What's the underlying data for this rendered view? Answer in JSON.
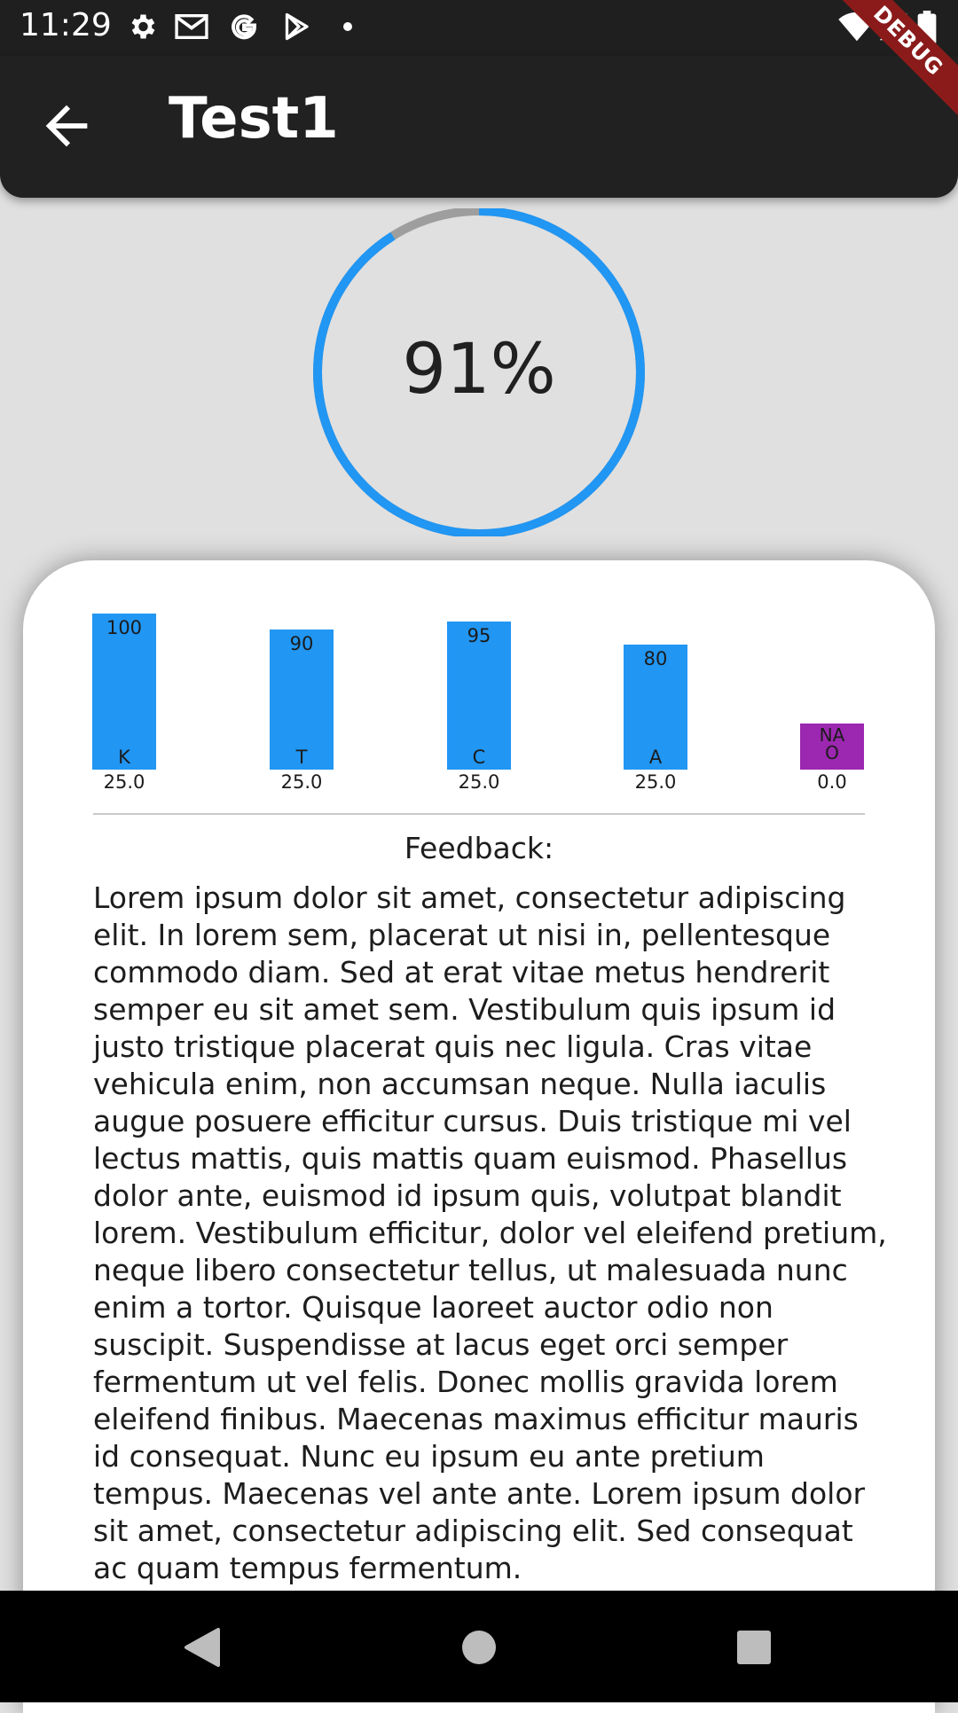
{
  "status_bar": {
    "time": "11:29",
    "left_icons": [
      "gear-icon",
      "gmail-icon",
      "google-icon",
      "play-store-icon",
      "dot-icon"
    ],
    "right_icons": [
      "wifi-icon",
      "signal-icon",
      "battery-icon"
    ]
  },
  "debug_banner": "DEBUG",
  "app_bar": {
    "title": "Test1",
    "back_icon": "arrow-back-icon"
  },
  "score": {
    "percent_label": "91%",
    "fraction": 0.91,
    "color": "#2196f3",
    "track_color": "#9e9e9e"
  },
  "chart_data": {
    "type": "bar",
    "categories": [
      "K",
      "T",
      "C",
      "A",
      "NAO"
    ],
    "values": [
      100,
      90,
      95,
      80,
      null
    ],
    "value_labels": [
      "100",
      "90",
      "95",
      "80",
      ""
    ],
    "weights": [
      "25.0",
      "25.0",
      "25.0",
      "25.0",
      "0.0"
    ],
    "na_label_lines": [
      "NA",
      "O"
    ],
    "bar_color": "#2196f3",
    "na_color": "#9c27b0"
  },
  "feedback": {
    "label": "Feedback:",
    "text": "Lorem ipsum dolor sit amet, consectetur adipiscing elit. In lorem sem, placerat ut nisi in, pellentesque commodo diam. Sed at erat vitae metus hendrerit semper eu sit amet sem. Vestibulum quis ipsum id justo tristique placerat quis nec ligula. Cras vitae vehicula enim, non accumsan neque. Nulla iaculis augue posuere efficitur cursus. Duis tristique mi vel lectus mattis, quis mattis quam euismod. Phasellus dolor ante, euismod id ipsum quis, volutpat blandit lorem. Vestibulum efficitur, dolor vel eleifend pretium, neque libero consectetur tellus, ut malesuada nunc enim a tortor. Quisque laoreet auctor odio non suscipit. Suspendisse at lacus eget orci semper fermentum ut vel felis. Donec mollis gravida lorem eleifend finibus. Maecenas maximus efficitur mauris id consequat. Nunc eu ipsum eu ante pretium tempus. Maecenas vel ante ante. Lorem ipsum dolor sit amet, consectetur adipiscing elit. Sed consequat ac quam tempus fermentum."
  },
  "nav_bar": {
    "buttons": [
      "back-triangle-icon",
      "home-circle-icon",
      "recents-square-icon"
    ]
  }
}
